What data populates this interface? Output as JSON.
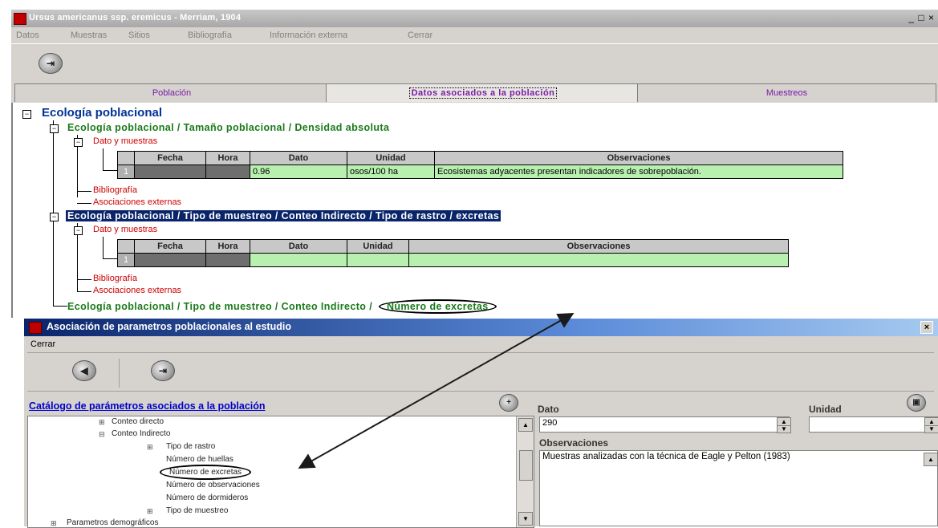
{
  "window": {
    "title": "Ursus americanus ssp. eremicus - Merriam, 1904",
    "controls": "_ □ ×"
  },
  "menu": [
    "Datos",
    "Muestras",
    "Sitios",
    "Bibliografía",
    "Información externa",
    "Cerrar"
  ],
  "tabs": {
    "poblacion": "Población",
    "datos": "Datos asociados a la población",
    "muestreos": "Muestreos"
  },
  "tree": {
    "root": "Ecología poblacional",
    "node1": "Ecología poblacional / Tamaño poblacional / Densidad absoluta",
    "node1_sub": "Dato y muestras",
    "node1_biblio": "Bibliografía",
    "node1_asoc": "Asociaciones externas",
    "node2": "Ecología poblacional / Tipo de muestreo / Conteo Indirecto / Tipo de rastro / excretas",
    "node2_sub": "Dato y muestras",
    "node2_biblio": "Bibliografía",
    "node2_asoc": "Asociaciones externas",
    "node3_prefix": "Ecología poblacional / Tipo de muestreo / Conteo Indirecto /",
    "node3_circled": "Número de excretas"
  },
  "table1": {
    "headers": [
      "Fecha",
      "Hora",
      "Dato",
      "Unidad",
      "Observaciones"
    ],
    "row": {
      "num": "1",
      "fecha": "",
      "hora": "",
      "dato": "0.96",
      "unidad": "osos/100 ha",
      "obs": "Ecosistemas adyacentes presentan indicadores de sobrepoblación."
    }
  },
  "table2": {
    "headers": [
      "Fecha",
      "Hora",
      "Dato",
      "Unidad",
      "Observaciones"
    ],
    "row": {
      "num": "1"
    }
  },
  "dialog": {
    "title": "Asociación de parametros poblacionales al estudio",
    "menu_close": "Cerrar",
    "catalog_title": "Catálogo de parámetros asociados a la población",
    "catalog_items": {
      "conteo_directo": "Conteo directo",
      "conteo_indirecto": "Conteo Indirecto",
      "tipo_rastro": "Tipo de rastro",
      "num_huellas": "Número de huellas",
      "num_excretas": "Número de excretas",
      "num_observaciones": "Número de observaciones",
      "num_dormideros": "Número de dormideros",
      "tipo_muestreo": "Tipo de muestreo",
      "param_demograficos": "Parametros demográficos"
    },
    "dato_label": "Dato",
    "dato_value": "290",
    "unidad_label": "Unidad",
    "unidad_value": "",
    "obs_label": "Observaciones",
    "obs_value": "Muestras analizadas con la técnica de Eagle y Pelton (1983)"
  },
  "colors": {
    "title_blue": "#003399",
    "node_green": "#1a7a1a",
    "leaf_red": "#cc0000",
    "selection": "#0a246a",
    "cell_green": "#b8f0b0",
    "tab_purple": "#7a1aa8"
  }
}
